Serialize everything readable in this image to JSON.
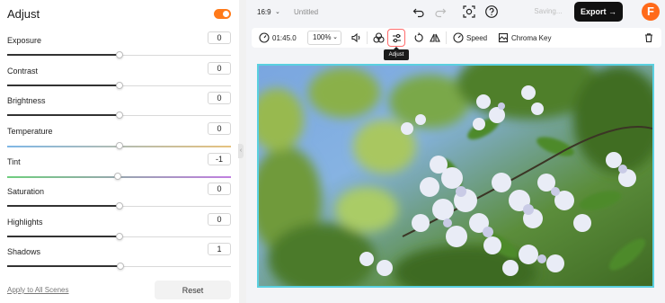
{
  "panel": {
    "title": "Adjust",
    "toggle_on": true,
    "rows": [
      {
        "label": "Exposure",
        "value": "0",
        "level": 0.5
      },
      {
        "label": "Contrast",
        "value": "0",
        "level": 0.5
      },
      {
        "label": "Brightness",
        "value": "0",
        "level": 0.5
      },
      {
        "label": "Temperature",
        "value": "0",
        "level": 0.5
      },
      {
        "label": "Tint",
        "value": "-1",
        "level": 0.495
      },
      {
        "label": "Saturation",
        "value": "0",
        "level": 0.5
      },
      {
        "label": "Highlights",
        "value": "0",
        "level": 0.5
      },
      {
        "label": "Shadows",
        "value": "1",
        "level": 0.505
      }
    ],
    "apply_all_label": "Apply to All Scenes",
    "reset_label": "Reset"
  },
  "header": {
    "aspect_ratio": "16:9",
    "title": "Untitled",
    "saving_label": "Saving...",
    "export_label": "Export",
    "logo_letter": "F"
  },
  "toolbar": {
    "duration": "01:45.0",
    "zoom": "100%",
    "speed_label": "Speed",
    "chroma_label": "Chroma Key",
    "tooltip": "Adjust"
  },
  "colors": {
    "accent": "#ff7a1a",
    "canvas_border": "#5ad0e0",
    "export_bg": "#111111"
  }
}
